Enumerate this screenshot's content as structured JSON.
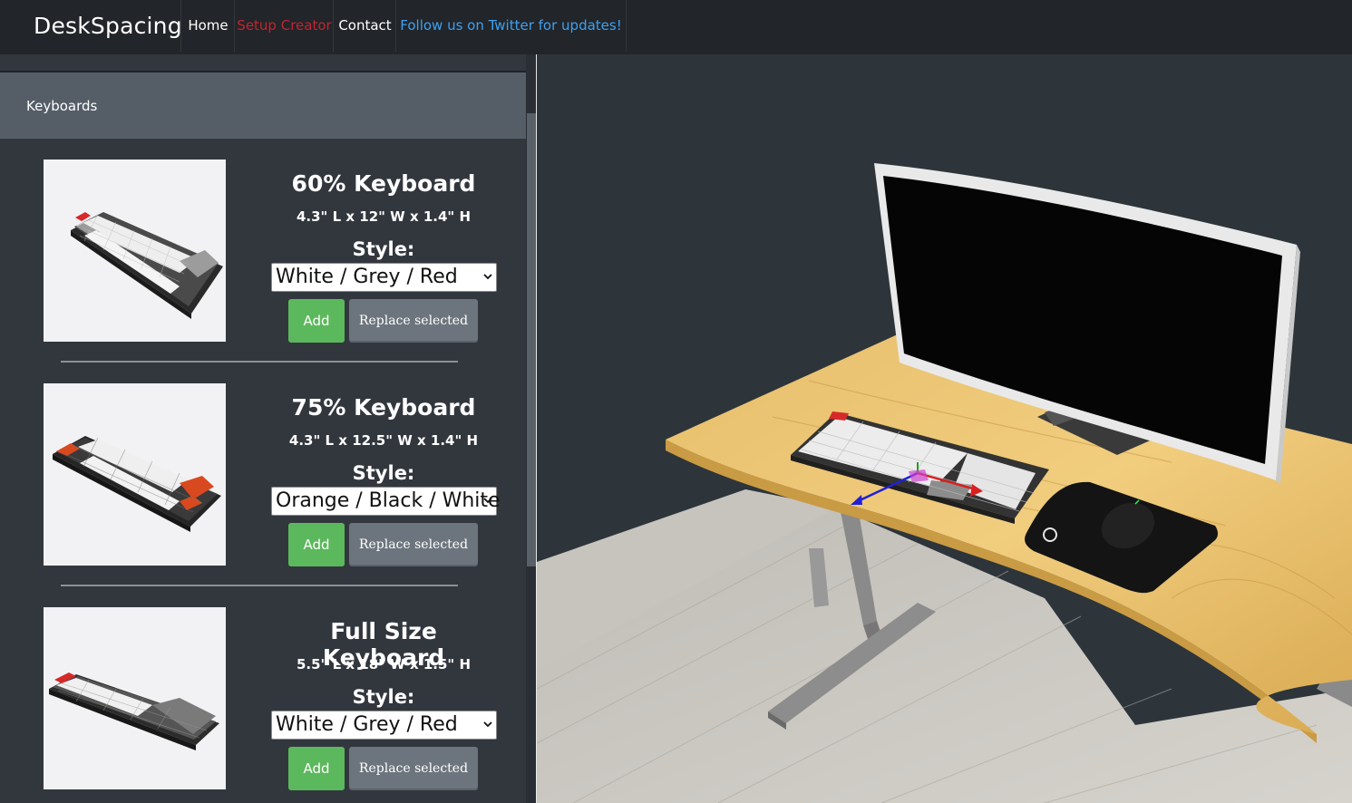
{
  "navbar": {
    "brand": "DeskSpacing",
    "links": [
      {
        "label": "Home",
        "active": false
      },
      {
        "label": "Setup Creator",
        "active": true
      },
      {
        "label": "Contact",
        "active": false
      }
    ],
    "twitter_text": "Follow us on Twitter for updates!",
    "twitter_icon": "twitter-bird-icon"
  },
  "sidebar": {
    "category": "Keyboards",
    "products": [
      {
        "title": "60% Keyboard",
        "dims": "4.3\" L x 12\" W x 1.4\" H",
        "style_label": "Style:",
        "style_value": "White / Grey / Red",
        "add_label": "Add",
        "replace_label": "Replace selected"
      },
      {
        "title": "75% Keyboard",
        "dims": "4.3\" L x 12.5\" W x 1.4\" H",
        "style_label": "Style:",
        "style_value": "Orange / Black / White",
        "add_label": "Add",
        "replace_label": "Replace selected"
      },
      {
        "title": "Full Size Keyboard",
        "dims": "5.5\" L x 18\" W x 1.5\" H",
        "style_label": "Style:",
        "style_value": "White / Grey / Red",
        "add_label": "Add",
        "replace_label": "Replace selected"
      }
    ]
  },
  "colors": {
    "navbar_bg": "#222529",
    "active_link": "#c1252f",
    "twitter_link": "#3ea1f2",
    "sidebar_bg": "#32373e",
    "header_bg": "#555e67",
    "add_button": "#5cb85c",
    "replace_button": "#6c757d",
    "viewport_bg": "#2d353b",
    "desk_wood": "#e5b964"
  }
}
